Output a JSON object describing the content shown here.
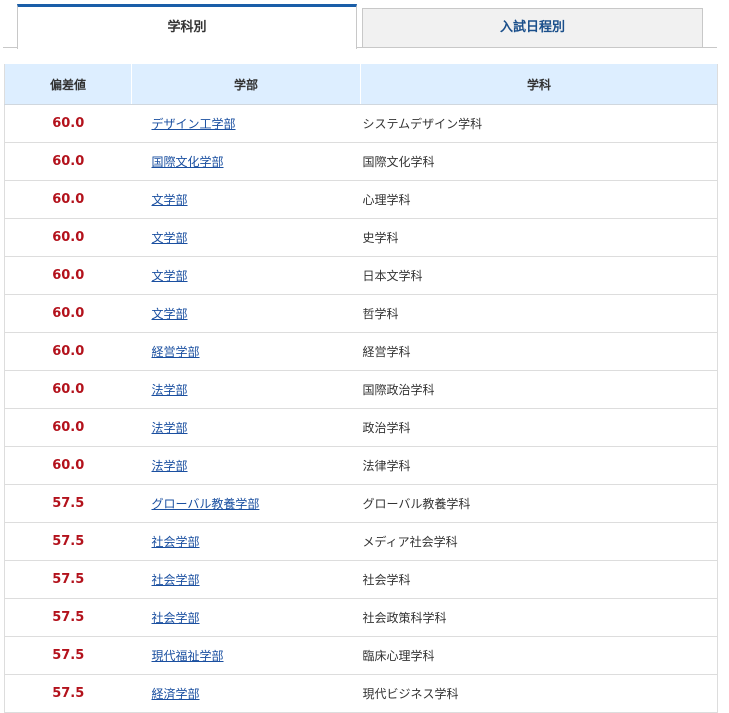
{
  "tabs": [
    {
      "label": "学科別",
      "active": true
    },
    {
      "label": "入試日程別",
      "active": false
    }
  ],
  "table": {
    "headers": [
      "偏差値",
      "学部",
      "学科"
    ],
    "rows": [
      {
        "score": "60.0",
        "faculty": "デザイン工学部",
        "department": "システムデザイン学科"
      },
      {
        "score": "60.0",
        "faculty": "国際文化学部",
        "department": "国際文化学科"
      },
      {
        "score": "60.0",
        "faculty": "文学部",
        "department": "心理学科"
      },
      {
        "score": "60.0",
        "faculty": "文学部",
        "department": "史学科"
      },
      {
        "score": "60.0",
        "faculty": "文学部",
        "department": "日本文学科"
      },
      {
        "score": "60.0",
        "faculty": "文学部",
        "department": "哲学科"
      },
      {
        "score": "60.0",
        "faculty": "経営学部",
        "department": "経営学科"
      },
      {
        "score": "60.0",
        "faculty": "法学部",
        "department": "国際政治学科"
      },
      {
        "score": "60.0",
        "faculty": "法学部",
        "department": "政治学科"
      },
      {
        "score": "60.0",
        "faculty": "法学部",
        "department": "法律学科"
      },
      {
        "score": "57.5",
        "faculty": "グローバル教養学部",
        "department": "グローバル教養学科"
      },
      {
        "score": "57.5",
        "faculty": "社会学部",
        "department": "メディア社会学科"
      },
      {
        "score": "57.5",
        "faculty": "社会学部",
        "department": "社会学科"
      },
      {
        "score": "57.5",
        "faculty": "社会学部",
        "department": "社会政策科学科"
      },
      {
        "score": "57.5",
        "faculty": "現代福祉学部",
        "department": "臨床心理学科"
      },
      {
        "score": "57.5",
        "faculty": "経済学部",
        "department": "現代ビジネス学科"
      }
    ]
  },
  "colors": {
    "accent": "#1a5ea8",
    "score": "#b3121c",
    "link": "#1a4fa0",
    "header_bg": "#ddeeff"
  }
}
